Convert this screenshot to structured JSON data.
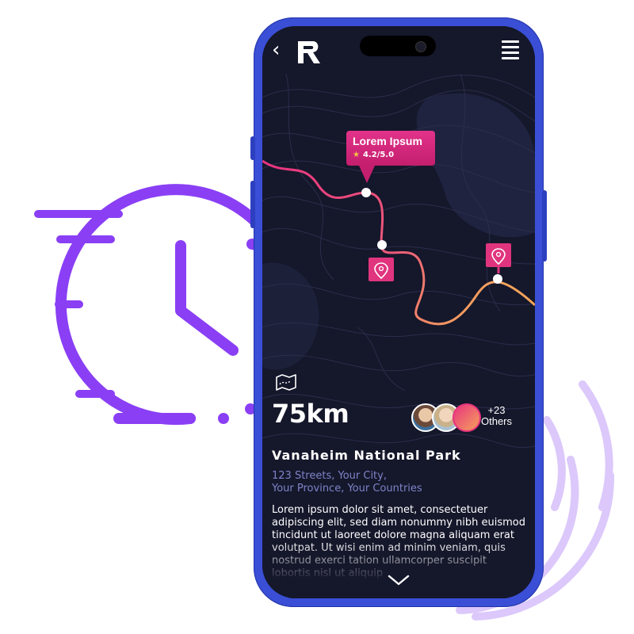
{
  "header": {
    "logo_letter": "R"
  },
  "map": {
    "tooltip": {
      "title": "Lorem Ipsum",
      "rating": "4.2/5.0"
    },
    "colors": {
      "route_start": "#e8337f",
      "route_end": "#f4a35b",
      "pin": "#e0357e"
    }
  },
  "trip": {
    "distance": "75km",
    "others_count": "+23",
    "others_label": "Others"
  },
  "place": {
    "name": "Vanaheim National Park",
    "address_line1": "123 Streets, Your City,",
    "address_line2": "Your Province, Your Countries",
    "description": "Lorem ipsum dolor sit amet, consectetuer adipiscing elit, sed diam nonummy nibh euismod tincidunt ut laoreet dolore magna aliquam erat volutpat. Ut wisi enim ad minim veniam, quis nostrud exerci tation ullamcorper suscipit lobortis nisl ut aliquip"
  },
  "colors": {
    "clock": "#8a3ff5",
    "rings": "#dcc8fb",
    "phone_frame": "#3a4fd6",
    "screen_bg": "#15172b",
    "address": "#7e84c8"
  }
}
